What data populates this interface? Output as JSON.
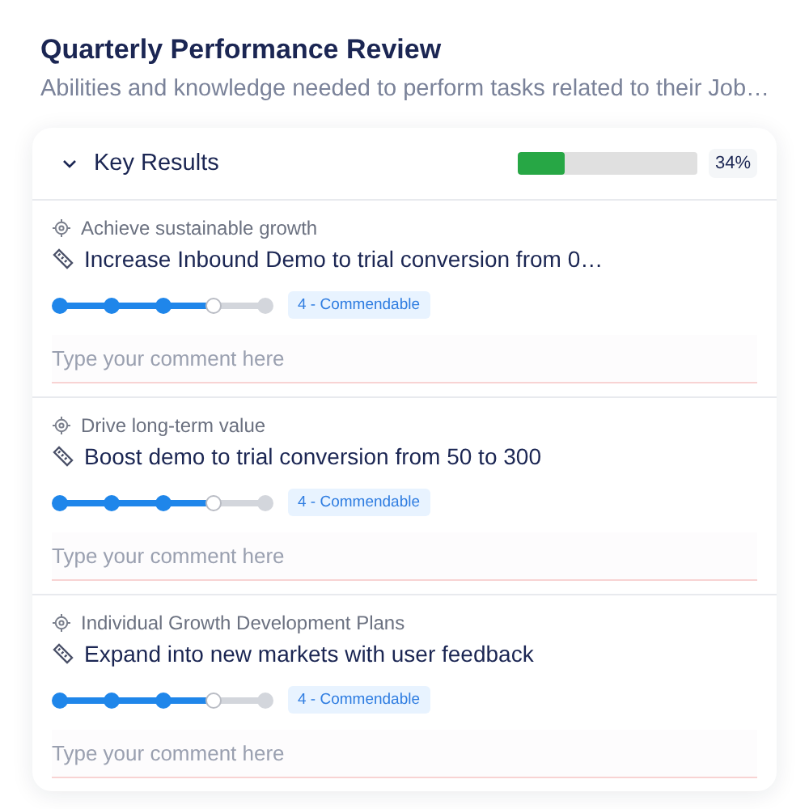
{
  "title": "Quarterly Performance Review",
  "subtitle": "Abilities and knowledge needed to perform tasks related to their Job…",
  "section": {
    "label": "Key Results",
    "expanded": true,
    "level": 0.26,
    "percent": "34%",
    "items": [
      {
        "objective": "Achieve sustainable growth",
        "key_result": "Increase Inbound Demo to trial conversion from 0…",
        "level": 0.75,
        "rating": "4 - Commendable",
        "placeholder": "Type your comment here"
      },
      {
        "objective": "Drive long-term value",
        "key_result": "Boost demo to trial conversion from 50 to 300",
        "level": 0.75,
        "rating": "4 - Commendable",
        "placeholder": "Type your comment here"
      },
      {
        "objective": "Individual Growth Development Plans",
        "key_result": "Expand into new markets with user feedback",
        "level": 0.75,
        "rating": "4 - Commendable",
        "placeholder": "Type your comment here"
      }
    ]
  }
}
